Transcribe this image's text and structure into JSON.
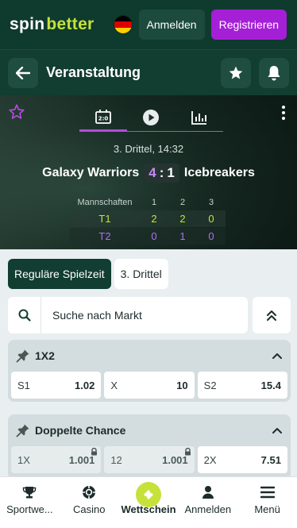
{
  "header": {
    "logo_part1": "spin",
    "logo_part2": "better",
    "login_label": "Anmelden",
    "register_label": "Registrieren",
    "flag_colors": [
      "#000000",
      "#dd0000",
      "#ffce00"
    ],
    "brand_accent": "#c6e23a",
    "register_color": "#a51fd6"
  },
  "event_bar": {
    "title": "Veranstaltung",
    "back_icon": "arrow-left-icon",
    "favorite_icon": "star-icon",
    "notify_icon": "bell-icon"
  },
  "scoreboard": {
    "period_time": "3. Drittel, 14:32",
    "home_team": "Galaxy Warriors",
    "away_team": "Icebreakers",
    "home_score": "4",
    "away_score": "1",
    "separator": ":",
    "tabs": [
      {
        "icon": "scoreboard-icon",
        "active": true
      },
      {
        "icon": "play-icon",
        "active": false
      },
      {
        "icon": "stats-icon",
        "active": false
      }
    ],
    "table": {
      "header": [
        "Mannschaften",
        "1",
        "2",
        "3"
      ],
      "rows": [
        {
          "label": "T1",
          "values": [
            "2",
            "2",
            "0"
          ]
        },
        {
          "label": "T2",
          "values": [
            "0",
            "1",
            "0"
          ]
        }
      ]
    }
  },
  "period_tabs": [
    {
      "label": "Reguläre Spielzeit",
      "active": true
    },
    {
      "label": "3. Drittel",
      "active": false
    }
  ],
  "search": {
    "placeholder": "Suche nach Markt"
  },
  "markets": [
    {
      "title": "1X2",
      "odds": [
        {
          "name": "S1",
          "value": "1.02",
          "locked": false
        },
        {
          "name": "X",
          "value": "10",
          "locked": false
        },
        {
          "name": "S2",
          "value": "15.4",
          "locked": false
        }
      ]
    },
    {
      "title": "Doppelte Chance",
      "odds": [
        {
          "name": "1X",
          "value": "1.001",
          "locked": true
        },
        {
          "name": "12",
          "value": "1.001",
          "locked": true
        },
        {
          "name": "2X",
          "value": "7.51",
          "locked": false
        }
      ]
    }
  ],
  "bottom_nav": [
    {
      "label": "Sportwe...",
      "icon": "trophy-icon"
    },
    {
      "label": "Casino",
      "icon": "casino-chip-icon"
    },
    {
      "label": "Wettschein",
      "icon": "ticket-icon"
    },
    {
      "label": "Anmelden",
      "icon": "user-icon"
    },
    {
      "label": "Menü",
      "icon": "menu-icon"
    }
  ]
}
